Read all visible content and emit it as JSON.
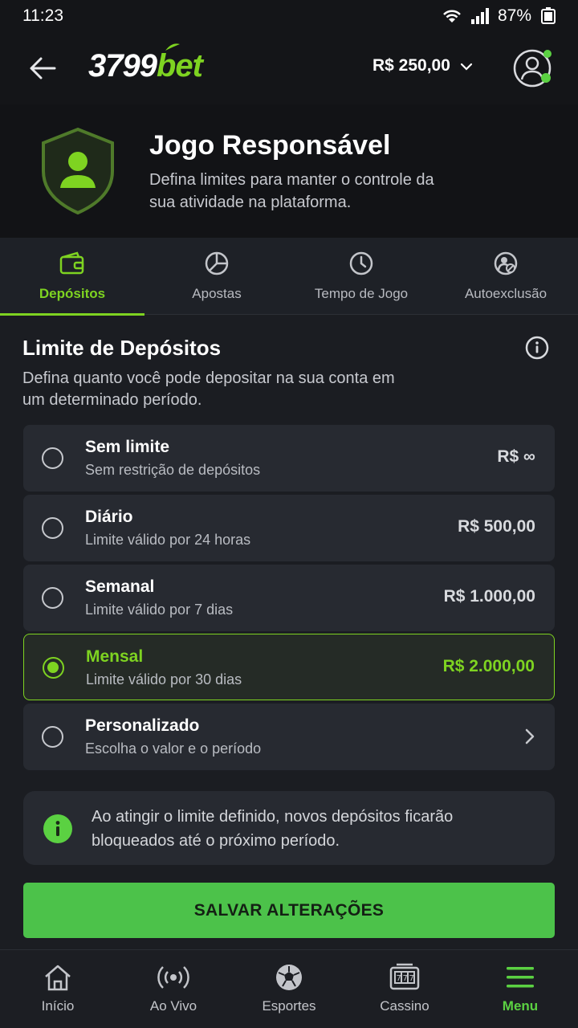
{
  "status_bar": {
    "time": "11:23",
    "battery": "87%"
  },
  "header": {
    "logo_num": "3799",
    "logo_bet": "bet",
    "balance": "R$ 250,00"
  },
  "hero": {
    "title": "Jogo Responsável",
    "description": "Defina limites para manter o controle da sua atividade na plataforma."
  },
  "tabs": [
    {
      "label": "Depósitos",
      "icon": "wallet-icon",
      "active": true
    },
    {
      "label": "Apostas",
      "icon": "pie-chart-icon",
      "active": false
    },
    {
      "label": "Tempo de Jogo",
      "icon": "clock-icon",
      "active": false
    },
    {
      "label": "Autoexclusão",
      "icon": "self-exclusion-icon",
      "active": false
    }
  ],
  "section": {
    "title": "Limite de Depósitos",
    "description": "Defina quanto você pode depositar na sua conta em um determinado período."
  },
  "options": [
    {
      "label": "Sem limite",
      "sub": "Sem restrição de depósitos",
      "value": "R$ ∞",
      "selected": false
    },
    {
      "label": "Diário",
      "sub": "Limite válido por 24 horas",
      "value": "R$ 500,00",
      "selected": false
    },
    {
      "label": "Semanal",
      "sub": "Limite válido por 7 dias",
      "value": "R$ 1.000,00",
      "selected": false
    },
    {
      "label": "Mensal",
      "sub": "Limite válido por 30 dias",
      "value": "R$ 2.000,00",
      "selected": true
    },
    {
      "label": "Personalizado",
      "sub": "Escolha o valor e o período",
      "value": "",
      "selected": false
    }
  ],
  "notice": {
    "text": "Ao atingir o limite definido, novos depósitos ficarão bloqueados até o próximo período."
  },
  "save_label": "SALVAR ALTERAÇÕES",
  "bottom_nav": [
    {
      "label": "Início",
      "icon": "home-icon",
      "active": false
    },
    {
      "label": "Ao Vivo",
      "icon": "live-broadcast-icon",
      "active": false
    },
    {
      "label": "Esportes",
      "icon": "soccer-ball-icon",
      "active": false
    },
    {
      "label": "Cassino",
      "icon": "slot-machine-icon",
      "active": false
    },
    {
      "label": "Menu",
      "icon": "menu-icon",
      "active": true
    }
  ],
  "colors": {
    "accent": "#7ed321",
    "button": "#4cc24a",
    "background": "#1b1d22"
  }
}
